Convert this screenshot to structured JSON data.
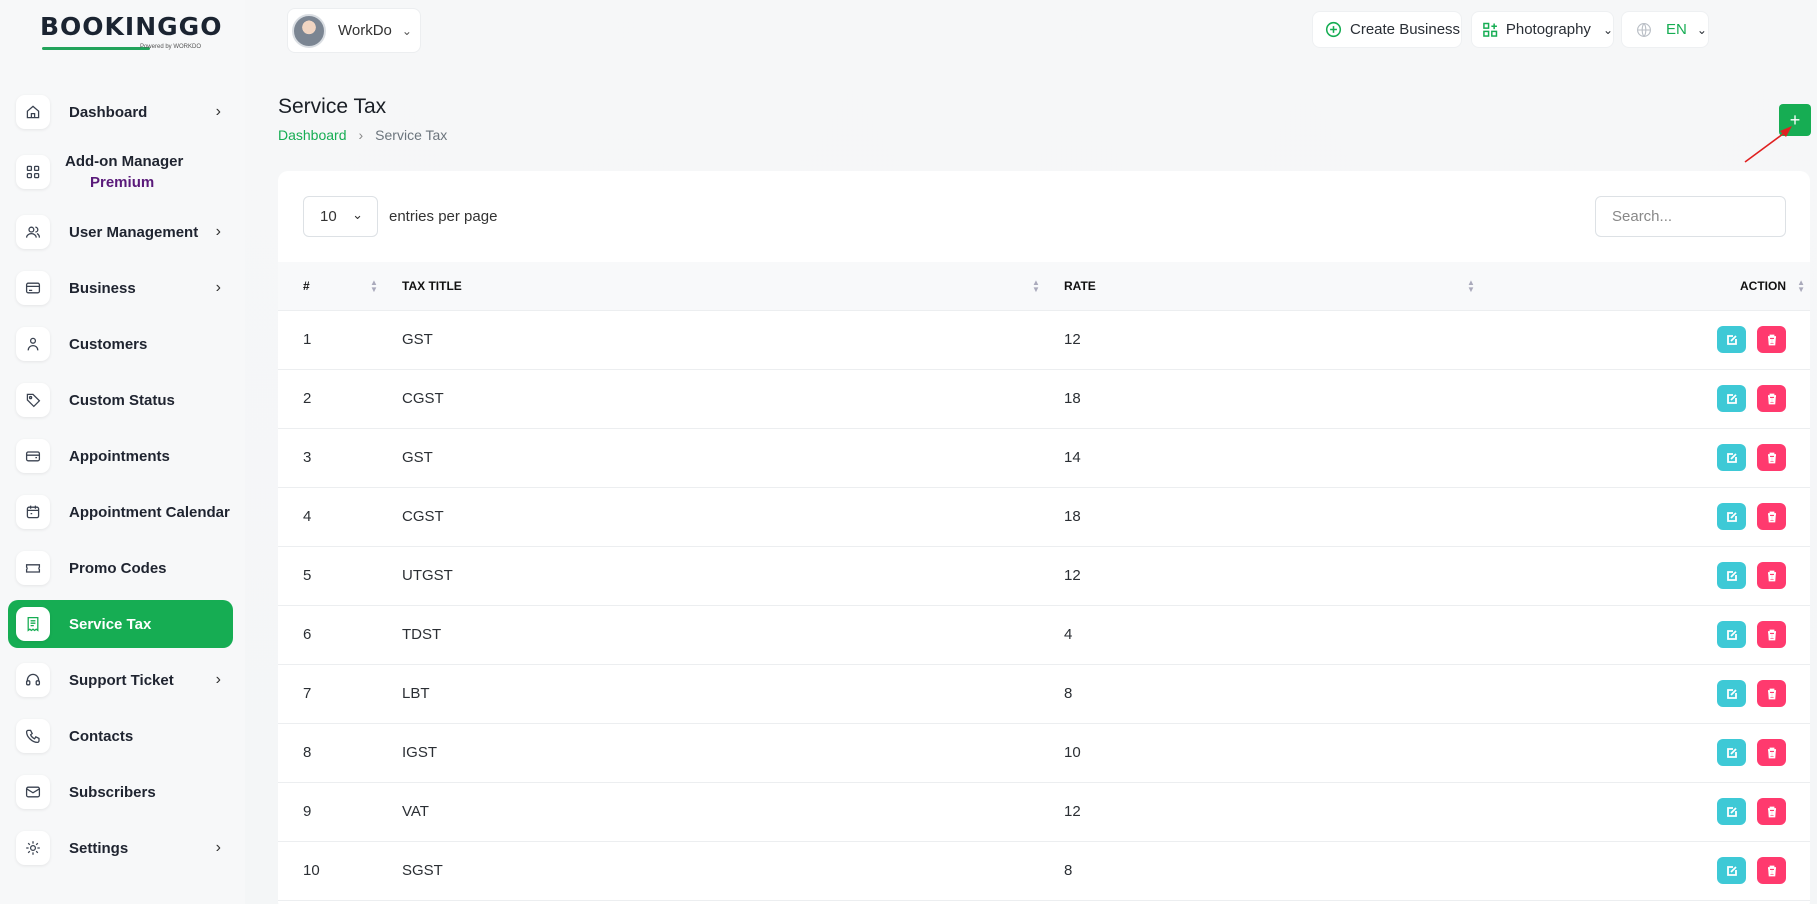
{
  "brand": {
    "logo_text": "BOOKINGGO",
    "logo_sub": "Powered by WORKDO"
  },
  "header": {
    "workspace_name": "WorkDo",
    "create_business": "Create Business",
    "business_select": "Photography",
    "language": "EN"
  },
  "sidebar": {
    "items": [
      {
        "label": "Dashboard",
        "icon": "home-icon",
        "chevron": "›"
      },
      {
        "label": "Add-on Manager",
        "sub": "Premium",
        "icon": "grid-icon"
      },
      {
        "label": "User Management",
        "icon": "users-icon",
        "chevron": "›"
      },
      {
        "label": "Business",
        "icon": "card-icon",
        "chevron": "›"
      },
      {
        "label": "Customers",
        "icon": "user-icon"
      },
      {
        "label": "Custom Status",
        "icon": "tag-icon"
      },
      {
        "label": "Appointments",
        "icon": "wallet-icon"
      },
      {
        "label": "Appointment Calendar",
        "icon": "calendar-icon"
      },
      {
        "label": "Promo Codes",
        "icon": "ticket-icon"
      },
      {
        "label": "Service Tax",
        "icon": "receipt-icon",
        "active": true
      },
      {
        "label": "Support Ticket",
        "icon": "headset-icon",
        "chevron": "›"
      },
      {
        "label": "Contacts",
        "icon": "phone-icon"
      },
      {
        "label": "Subscribers",
        "icon": "mail-icon"
      },
      {
        "label": "Settings",
        "icon": "gear-icon",
        "chevron": "›"
      }
    ]
  },
  "page": {
    "title": "Service Tax",
    "breadcrumb": {
      "home": "Dashboard",
      "separator": "›",
      "current": "Service Tax"
    },
    "add_label": "+"
  },
  "table": {
    "page_size": "10",
    "entries_label": "entries per page",
    "search_placeholder": "Search...",
    "columns": [
      "#",
      "TAX TITLE",
      "RATE",
      "ACTION"
    ],
    "rows": [
      {
        "num": "1",
        "title": "GST",
        "rate": "12"
      },
      {
        "num": "2",
        "title": "CGST",
        "rate": "18"
      },
      {
        "num": "3",
        "title": "GST",
        "rate": "14"
      },
      {
        "num": "4",
        "title": "CGST",
        "rate": "18"
      },
      {
        "num": "5",
        "title": "UTGST",
        "rate": "12"
      },
      {
        "num": "6",
        "title": "TDST",
        "rate": "4"
      },
      {
        "num": "7",
        "title": "LBT",
        "rate": "8"
      },
      {
        "num": "8",
        "title": "IGST",
        "rate": "10"
      },
      {
        "num": "9",
        "title": "VAT",
        "rate": "12"
      },
      {
        "num": "10",
        "title": "SGST",
        "rate": "8"
      }
    ]
  },
  "colors": {
    "accent": "#16ad53",
    "edit": "#3ec9d6",
    "delete": "#ff3a6e"
  }
}
